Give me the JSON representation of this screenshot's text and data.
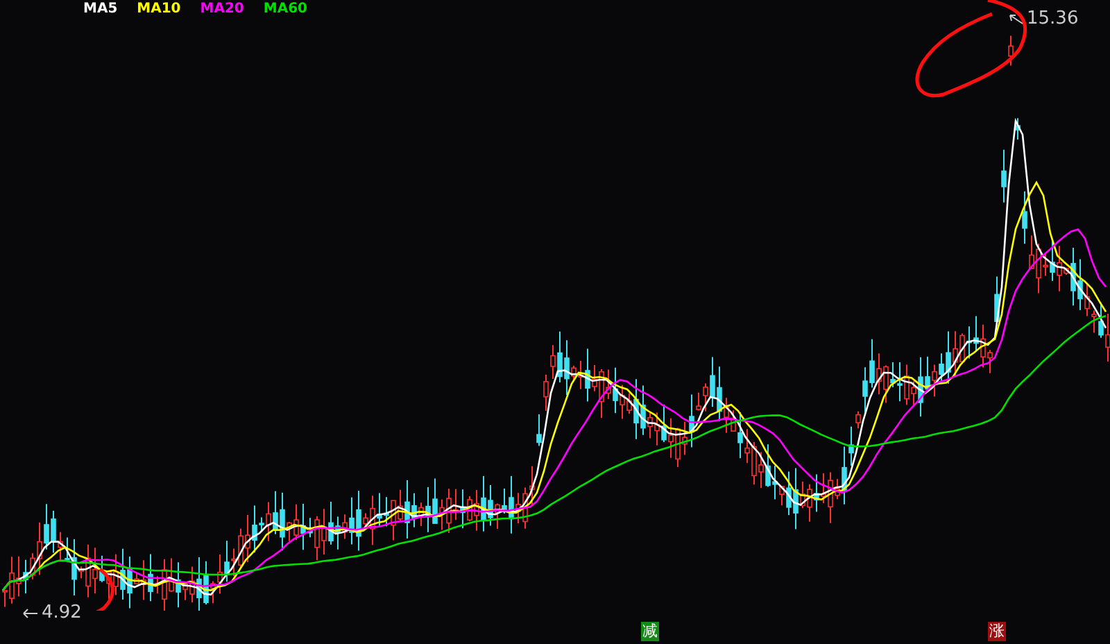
{
  "legend": [
    {
      "label": "MA5",
      "color": "#ffffff"
    },
    {
      "label": "MA10",
      "color": "#ffff00"
    },
    {
      "label": "MA20",
      "color": "#ff00ff"
    },
    {
      "label": "MA60",
      "color": "#00e000"
    }
  ],
  "price_labels": [
    {
      "kind": "high",
      "text": "15.36"
    },
    {
      "kind": "low",
      "text": "4.92"
    }
  ],
  "markers": [
    {
      "text": "减",
      "color": "#168a16"
    },
    {
      "text": "涨",
      "color": "#9a1010"
    }
  ]
}
